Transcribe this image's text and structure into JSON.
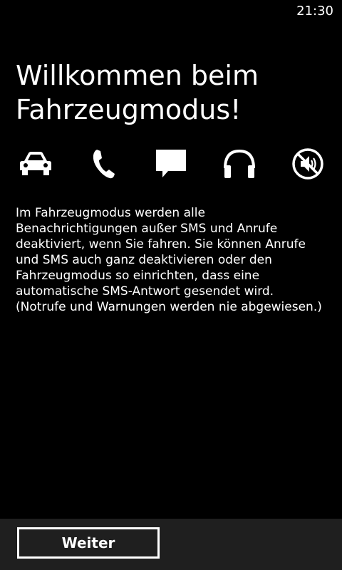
{
  "status_bar": {
    "time": "21:30"
  },
  "main": {
    "title": "Willkommen beim Fahrzeugmodus!",
    "icons": [
      "car-icon",
      "phone-icon",
      "message-icon",
      "headphones-icon",
      "muted-speaker-icon"
    ],
    "description": "Im Fahrzeugmodus werden alle Benachrichtigungen außer SMS und Anrufe deaktiviert, wenn Sie fahren. Sie können Anrufe und SMS auch ganz deaktivieren oder den Fahrzeugmodus so einrichten, dass eine automatische SMS-Antwort gesendet wird. (Notrufe und Warnungen werden nie abgewiesen.)"
  },
  "app_bar": {
    "continue_label": "Weiter"
  },
  "colors": {
    "background": "#000000",
    "foreground": "#ffffff",
    "app_bar": "#1f1f1f"
  }
}
